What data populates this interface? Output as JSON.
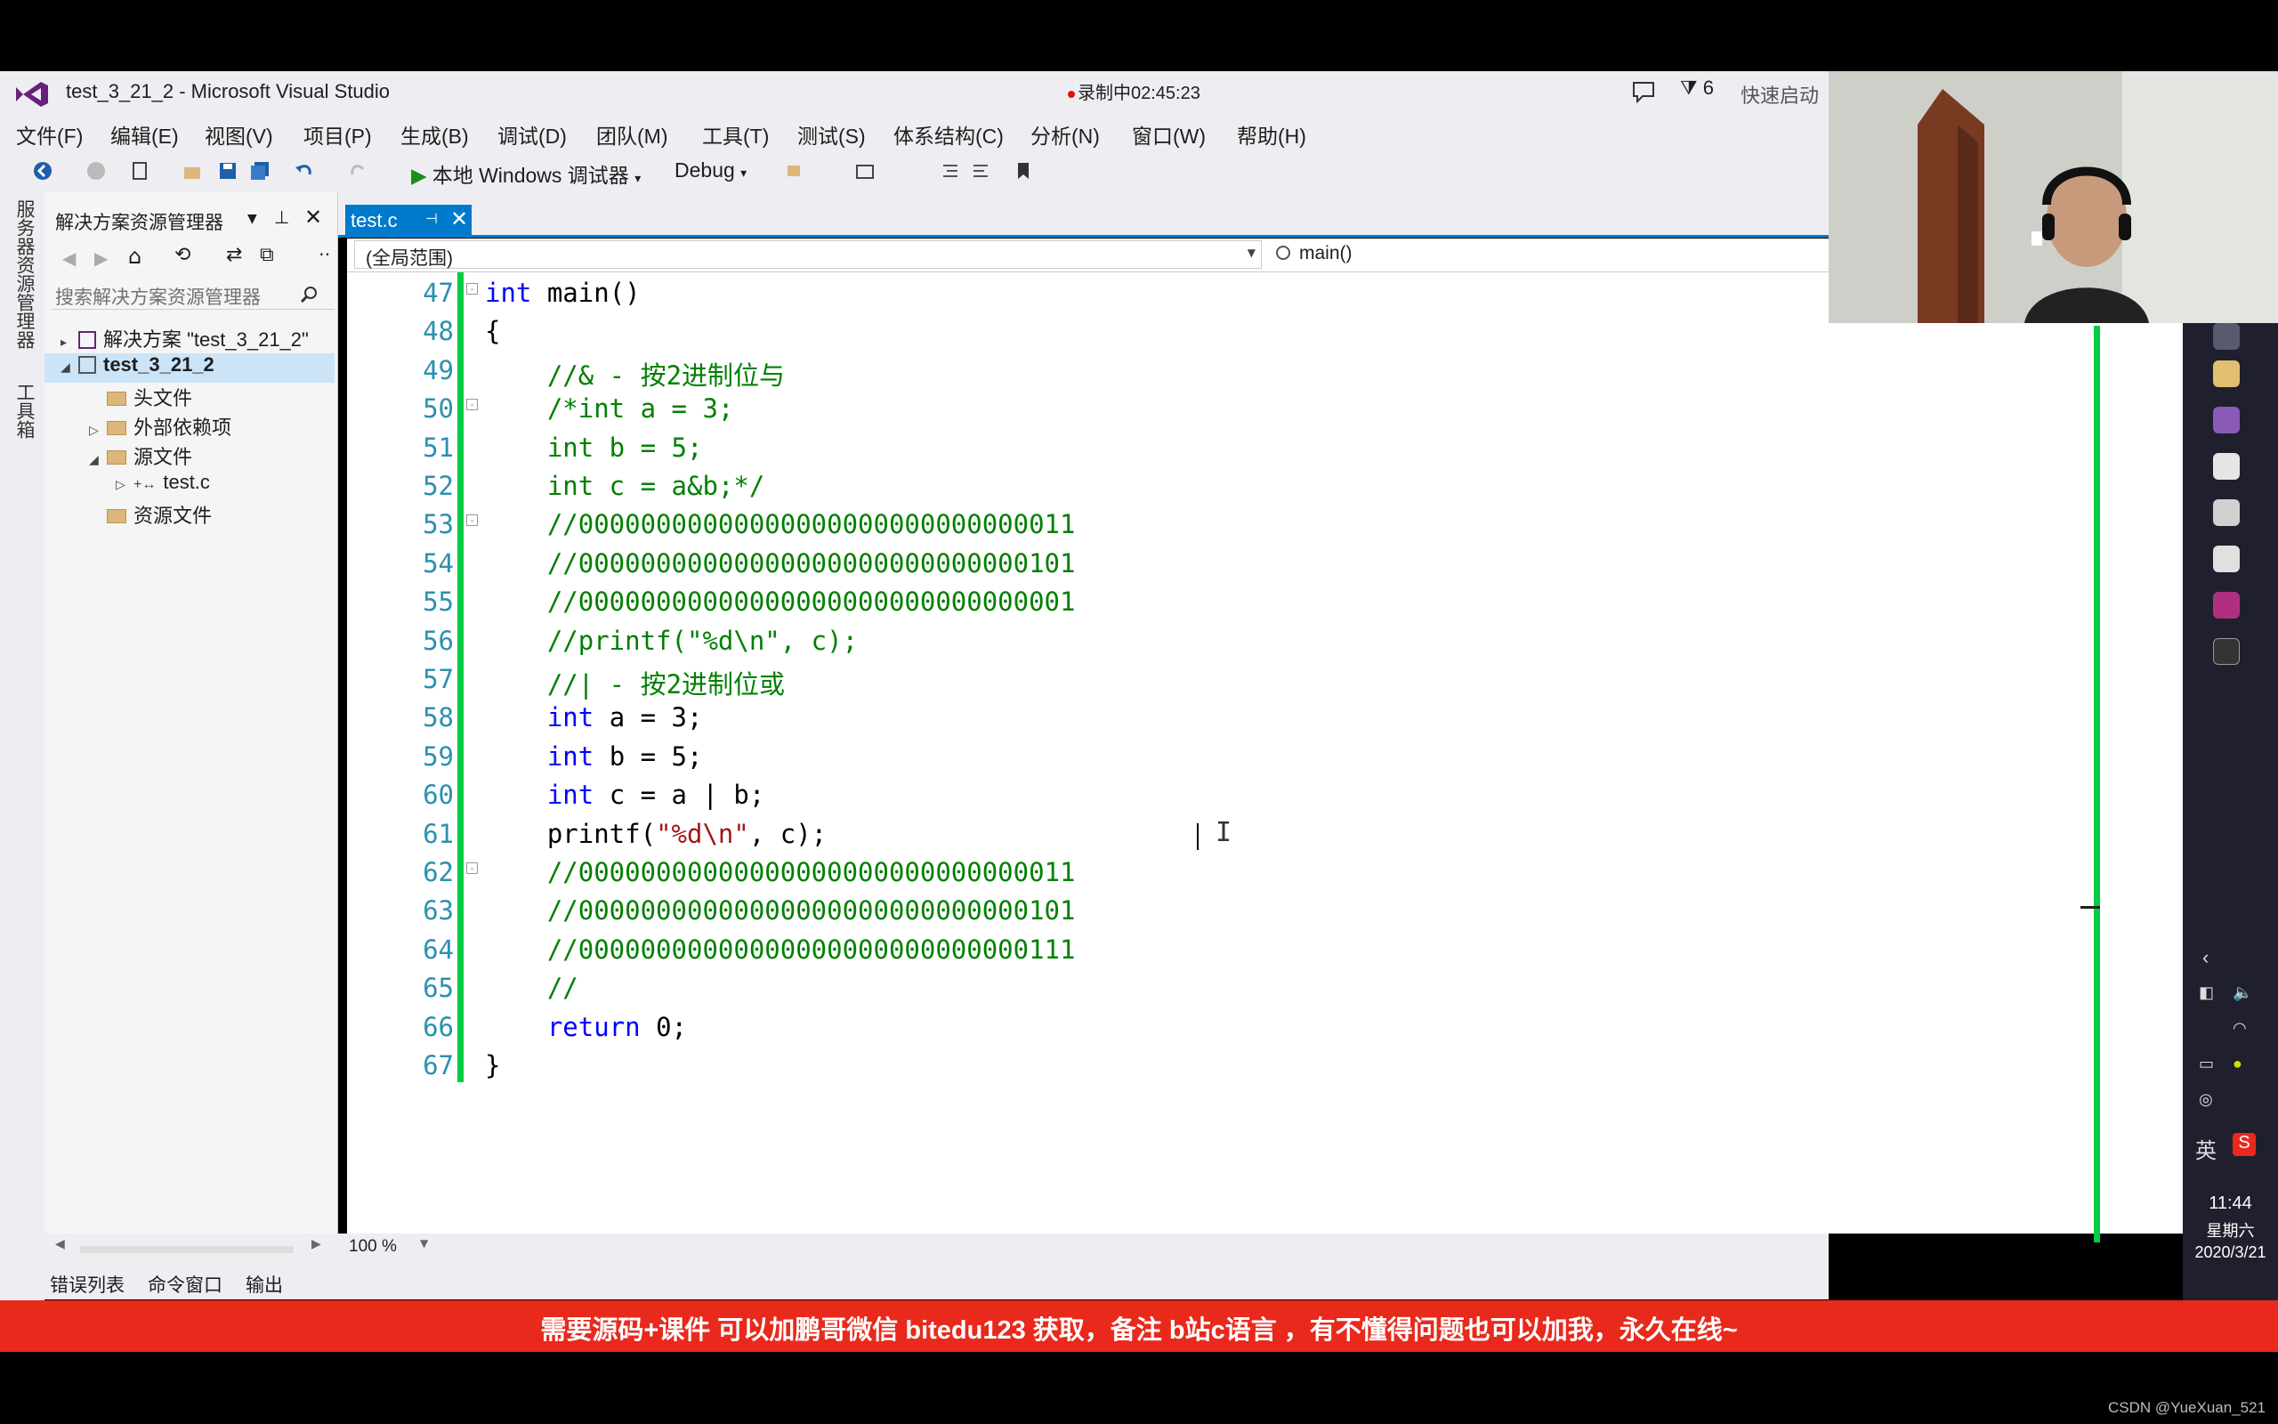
{
  "window": {
    "title": "test_3_21_2 - Microsoft Visual Studio",
    "recording": "录制中02:45:23",
    "filter_count": "6",
    "quick_launch": "快速启动"
  },
  "menu": [
    "文件(F)",
    "编辑(E)",
    "视图(V)",
    "项目(P)",
    "生成(B)",
    "调试(D)",
    "团队(M)",
    "工具(T)",
    "测试(S)",
    "体系结构(C)",
    "分析(N)",
    "窗口(W)",
    "帮助(H)"
  ],
  "toolbar": {
    "run_label": "本地 Windows 调试器",
    "config": "Debug"
  },
  "left_strip": {
    "server_explorer": "服务器资源管理器",
    "toolbox": "工具箱"
  },
  "solution_explorer": {
    "title": "解决方案资源管理器",
    "search_placeholder": "搜索解决方案资源管理器",
    "tree": [
      {
        "label": "解决方案 \"test_3_21_2\"",
        "depth": 0,
        "icon": "solution-icon",
        "arrow": "▸"
      },
      {
        "label": "test_3_21_2",
        "depth": 0,
        "icon": "project-icon",
        "arrow": "◢"
      },
      {
        "label": "头文件",
        "depth": 1,
        "icon": "folder-icon",
        "arrow": ""
      },
      {
        "label": "外部依赖项",
        "depth": 1,
        "icon": "folder-icon",
        "arrow": "▷"
      },
      {
        "label": "源文件",
        "depth": 1,
        "icon": "folder-icon",
        "arrow": "◢"
      },
      {
        "label": "test.c",
        "depth": 2,
        "icon": "c-file-icon",
        "arrow": "▷"
      },
      {
        "label": "资源文件",
        "depth": 1,
        "icon": "folder-icon",
        "arrow": ""
      }
    ]
  },
  "editor": {
    "tab_label": "test.c",
    "scope": "(全局范围)",
    "function": "main()",
    "zoom": "100 %",
    "lines": [
      {
        "n": "47",
        "fold": "-",
        "tokens": [
          [
            "kw",
            "int"
          ],
          [
            "tx",
            " main()"
          ]
        ]
      },
      {
        "n": "48",
        "fold": "",
        "tokens": [
          [
            "tx",
            "{"
          ]
        ]
      },
      {
        "n": "49",
        "fold": "",
        "tokens": [
          [
            "tx",
            "    "
          ],
          [
            "cm",
            "//& - 按2进制位与"
          ]
        ]
      },
      {
        "n": "50",
        "fold": "-",
        "tokens": [
          [
            "tx",
            "    "
          ],
          [
            "cm",
            "/*int a = 3;"
          ]
        ]
      },
      {
        "n": "51",
        "fold": "",
        "tokens": [
          [
            "tx",
            "    "
          ],
          [
            "cm",
            "int b = 5;"
          ]
        ]
      },
      {
        "n": "52",
        "fold": "",
        "tokens": [
          [
            "tx",
            "    "
          ],
          [
            "cm",
            "int c = a&b;*/"
          ]
        ]
      },
      {
        "n": "53",
        "fold": "-",
        "tokens": [
          [
            "tx",
            "    "
          ],
          [
            "cm",
            "//00000000000000000000000000000011"
          ]
        ]
      },
      {
        "n": "54",
        "fold": "",
        "tokens": [
          [
            "tx",
            "    "
          ],
          [
            "cm",
            "//00000000000000000000000000000101"
          ]
        ]
      },
      {
        "n": "55",
        "fold": "",
        "tokens": [
          [
            "tx",
            "    "
          ],
          [
            "cm",
            "//00000000000000000000000000000001"
          ]
        ]
      },
      {
        "n": "56",
        "fold": "",
        "tokens": [
          [
            "tx",
            "    "
          ],
          [
            "cm",
            "//printf(\"%d\\n\", c);"
          ]
        ]
      },
      {
        "n": "57",
        "fold": "",
        "tokens": [
          [
            "tx",
            "    "
          ],
          [
            "cm",
            "//| - 按2进制位或"
          ]
        ]
      },
      {
        "n": "58",
        "fold": "",
        "tokens": [
          [
            "tx",
            "    "
          ],
          [
            "kw",
            "int"
          ],
          [
            "tx",
            " a = 3;"
          ]
        ]
      },
      {
        "n": "59",
        "fold": "",
        "tokens": [
          [
            "tx",
            "    "
          ],
          [
            "kw",
            "int"
          ],
          [
            "tx",
            " b = 5;"
          ]
        ]
      },
      {
        "n": "60",
        "fold": "",
        "tokens": [
          [
            "tx",
            "    "
          ],
          [
            "kw",
            "int"
          ],
          [
            "tx",
            " c = a | b;"
          ]
        ]
      },
      {
        "n": "61",
        "fold": "",
        "tokens": [
          [
            "tx",
            "    printf("
          ],
          [
            "st",
            "\"%d\\n\""
          ],
          [
            "tx",
            ", c);"
          ]
        ]
      },
      {
        "n": "62",
        "fold": "-",
        "tokens": [
          [
            "tx",
            "    "
          ],
          [
            "cm",
            "//00000000000000000000000000000011"
          ]
        ]
      },
      {
        "n": "63",
        "fold": "",
        "tokens": [
          [
            "tx",
            "    "
          ],
          [
            "cm",
            "//00000000000000000000000000000101"
          ]
        ]
      },
      {
        "n": "64",
        "fold": "",
        "tokens": [
          [
            "tx",
            "    "
          ],
          [
            "cm",
            "//00000000000000000000000000000111"
          ]
        ]
      },
      {
        "n": "65",
        "fold": "",
        "tokens": [
          [
            "tx",
            "    "
          ],
          [
            "cm",
            "//"
          ]
        ]
      },
      {
        "n": "66",
        "fold": "",
        "tokens": [
          [
            "tx",
            "    "
          ],
          [
            "kw",
            "return"
          ],
          [
            "tx",
            " 0;"
          ]
        ]
      },
      {
        "n": "67",
        "fold": "",
        "tokens": [
          [
            "tx",
            "}"
          ]
        ]
      }
    ]
  },
  "bottom_tabs": [
    "错误列表",
    "命令窗口",
    "输出"
  ],
  "banner": "需要源码+课件 可以加鹏哥微信 bitedu123 获取，备注 b站c语言 ，有不懂得问题也可以加我，永久在线~",
  "taskbar": {
    "ime": "英",
    "time": "11:44",
    "weekday": "星期六",
    "date": "2020/3/21"
  },
  "watermark": "CSDN @YueXuan_521",
  "colors": {
    "accent": "#007acc",
    "banner": "#e8291c",
    "keyword": "#0000ff",
    "comment": "#008000",
    "string": "#a31515",
    "line_number": "#2b91af",
    "change_bar": "#00cc44"
  }
}
